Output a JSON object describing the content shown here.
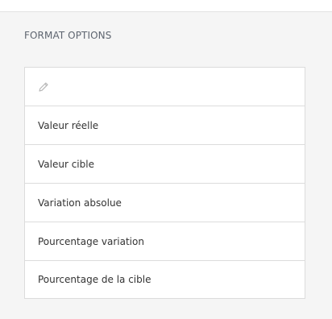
{
  "panel": {
    "title": "FORMAT OPTIONS",
    "edit_icon": "pencil-icon",
    "options": [
      "Valeur réelle",
      "Valeur cible",
      "Variation absolue",
      "Pourcentage variation",
      "Pourcentage de la cible"
    ]
  },
  "colors": {
    "background": "#f5f5f5",
    "card": "#ffffff",
    "border": "#dcdcdc",
    "title_text": "#5e6570",
    "item_text": "#333333",
    "icon": "#b5b5b5"
  }
}
